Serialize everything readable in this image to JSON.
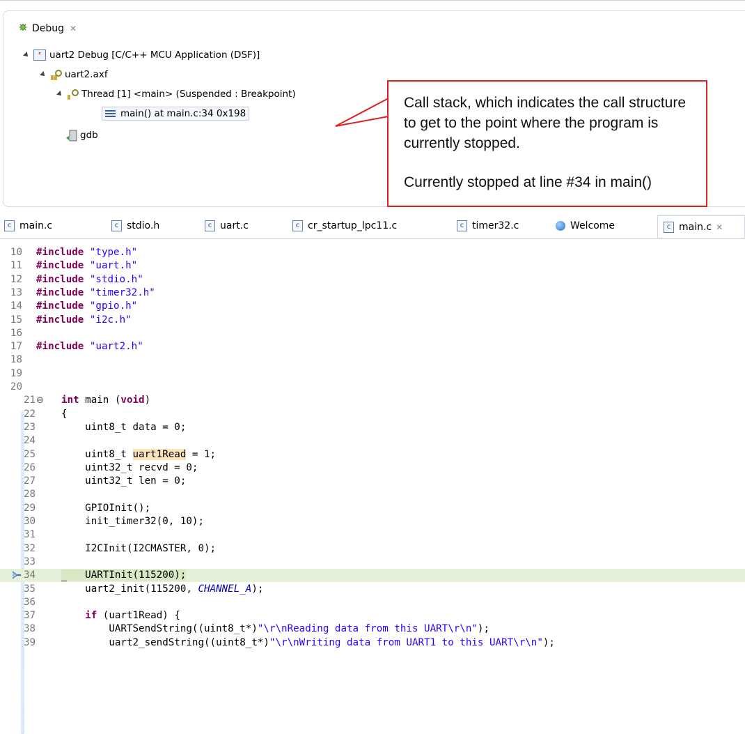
{
  "debug": {
    "title": "Debug",
    "tree": {
      "launch": "uart2 Debug [C/C++ MCU Application (DSF)]",
      "process": "uart2.axf",
      "thread": "Thread [1] <main> (Suspended : Breakpoint)",
      "frame": "main() at main.c:34 0x198",
      "gdb": "gdb"
    }
  },
  "callout": {
    "line1": "Call stack, which indicates the call structure to get to the point where the program is currently stopped.",
    "line2": "Currently stopped at line #34 in main()",
    "border_color": "#e02020"
  },
  "tabs": [
    {
      "label": "main.c",
      "icon": "c-file-icon"
    },
    {
      "label": "stdio.h",
      "icon": "c-file-icon"
    },
    {
      "label": "uart.c",
      "icon": "c-file-icon"
    },
    {
      "label": "cr_startup_lpc11.c",
      "icon": "c-file-icon"
    },
    {
      "label": "timer32.c",
      "icon": "c-file-icon"
    },
    {
      "label": "Welcome",
      "icon": "globe-icon"
    },
    {
      "label": "main.c",
      "icon": "c-file-icon",
      "active": true
    }
  ],
  "code": [
    {
      "n": "10",
      "t": "#include \"type.h\""
    },
    {
      "n": "11",
      "t": "#include \"uart.h\""
    },
    {
      "n": "12",
      "t": "#include \"stdio.h\""
    },
    {
      "n": "13",
      "t": "#include \"timer32.h\""
    },
    {
      "n": "14",
      "t": "#include \"gpio.h\""
    },
    {
      "n": "15",
      "t": "#include \"i2c.h\""
    },
    {
      "n": "16",
      "t": ""
    },
    {
      "n": "17",
      "t": "#include \"uart2.h\""
    },
    {
      "n": "18",
      "t": ""
    },
    {
      "n": "19",
      "t": ""
    },
    {
      "n": "20",
      "t": ""
    },
    {
      "n": "21",
      "t": "int main (void)"
    },
    {
      "n": "22",
      "t": "{"
    },
    {
      "n": "23",
      "t": "    uint8_t data = 0;"
    },
    {
      "n": "24",
      "t": ""
    },
    {
      "n": "25",
      "t": "    uint8_t uart1Read = 1;"
    },
    {
      "n": "26",
      "t": "    uint32_t recvd = 0;"
    },
    {
      "n": "27",
      "t": "    uint32_t len = 0;"
    },
    {
      "n": "28",
      "t": ""
    },
    {
      "n": "29",
      "t": "    GPIOInit();"
    },
    {
      "n": "30",
      "t": "    init_timer32(0, 10);"
    },
    {
      "n": "31",
      "t": ""
    },
    {
      "n": "32",
      "t": "    I2CInit(I2CMASTER, 0);"
    },
    {
      "n": "33",
      "t": ""
    },
    {
      "n": "34",
      "t": "    UARTInit(115200);"
    },
    {
      "n": "35",
      "t": "    uart2_init(115200, CHANNEL_A);"
    },
    {
      "n": "36",
      "t": ""
    },
    {
      "n": "37",
      "t": "    if (uart1Read) {"
    },
    {
      "n": "38",
      "t": "        UARTSendString((uint8_t*)\"\\r\\nReading data from this UART\\r\\n\");"
    },
    {
      "n": "39",
      "t": "        uart2_sendString((uint8_t*)\"\\r\\nWriting data from UART1 to this UART\\r\\n\");"
    }
  ],
  "current_line": "34"
}
